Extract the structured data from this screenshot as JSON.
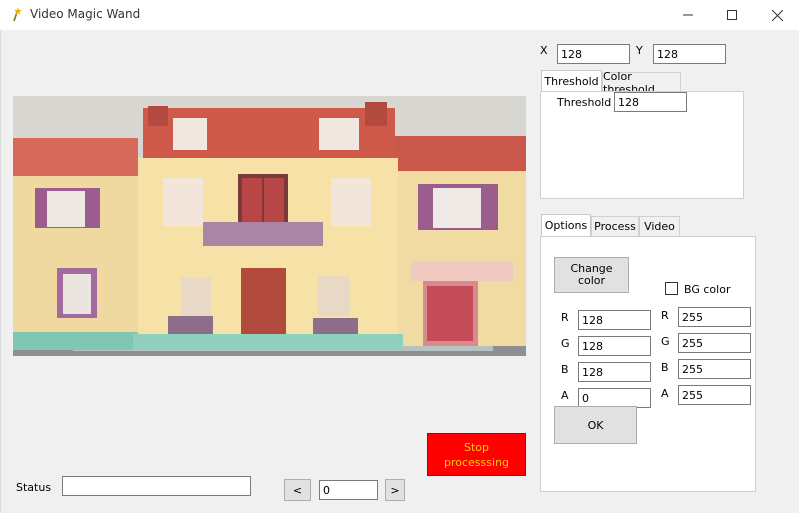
{
  "window": {
    "title": "Video Magic Wand",
    "minimize_icon": "minimize-icon",
    "maximize_icon": "maximize-icon",
    "close_icon": "close-icon",
    "app_icon": "magic-wand-icon"
  },
  "coords": {
    "x_label": "X",
    "x_value": "128",
    "y_label": "Y",
    "y_value": "128"
  },
  "threshold_tabs": {
    "tabs": [
      "Threshold",
      "Color threshold"
    ],
    "active": "Threshold",
    "threshold_label": "Threshold",
    "threshold_value": "128"
  },
  "options_tabs": {
    "tabs": [
      "Options",
      "Process",
      "Video"
    ],
    "active": "Options",
    "change_color_label": "Change color",
    "bg_color_label": "BG color",
    "bg_color_checked": false,
    "left_channels": [
      {
        "label": "R",
        "value": "128"
      },
      {
        "label": "G",
        "value": "128"
      },
      {
        "label": "B",
        "value": "128"
      },
      {
        "label": "A",
        "value": "0"
      }
    ],
    "right_channels": [
      {
        "label": "R",
        "value": "255"
      },
      {
        "label": "G",
        "value": "255"
      },
      {
        "label": "B",
        "value": "255"
      },
      {
        "label": "A",
        "value": "255"
      }
    ],
    "ok_label": "OK"
  },
  "bottom": {
    "status_label": "Status",
    "status_value": "",
    "prev_label": "<",
    "frame_value": "0",
    "next_label": ">",
    "stop_label": "Stop processsing",
    "stop_bg": "#ff0000",
    "stop_fg": "#ffcc00"
  },
  "preview": {
    "subject": "dollhouse-image"
  }
}
